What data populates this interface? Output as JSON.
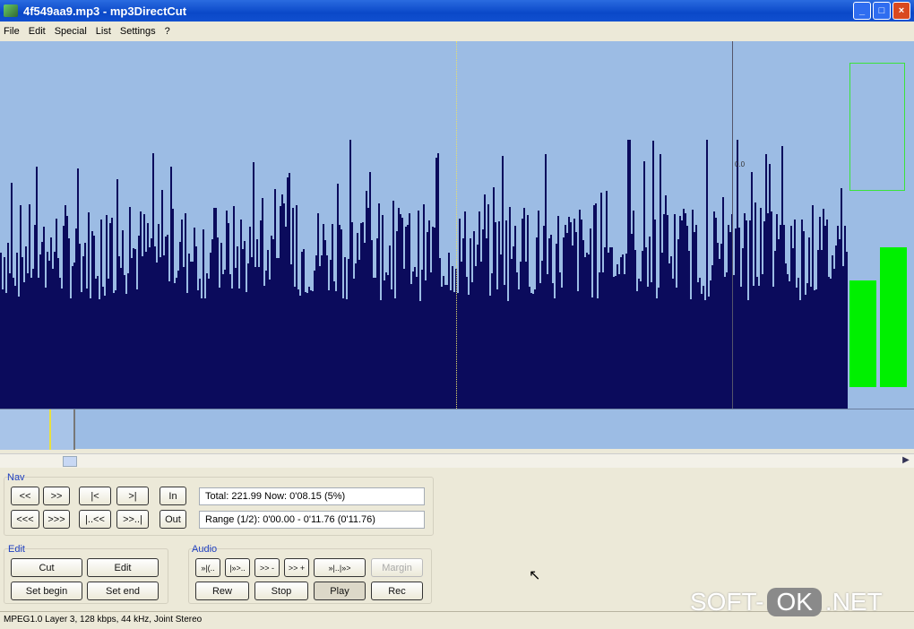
{
  "window": {
    "title": "4f549aa9.mp3 - mp3DirectCut",
    "buttons": [
      "_",
      "□",
      "×"
    ]
  },
  "menu": [
    "File",
    "Edit",
    "Special",
    "List",
    "Settings",
    "?"
  ],
  "waveform": {
    "level_label": "0.0",
    "meter_levels": [
      0.29,
      0.38
    ]
  },
  "nav": {
    "label": "Nav",
    "buttons": [
      "<<",
      ">>",
      "|<",
      ">|",
      "In",
      "<<<",
      ">>>",
      "|..<<",
      ">>..|",
      "Out"
    ],
    "info_total": "Total: 221.99  Now: 0'08.15  (5%)",
    "info_range": "Range (1/2): 0'00.00 - 0'11.76 (0'11.76)"
  },
  "edit": {
    "label": "Edit",
    "buttons": [
      "Cut",
      "Edit",
      "Set begin",
      "Set end"
    ]
  },
  "audio": {
    "label": "Audio",
    "buttons": [
      "»|(..",
      "|»>..",
      ">> -",
      ">> +",
      "»|..|»>",
      "Margin",
      "Rew",
      "Stop",
      "Play",
      "Rec"
    ]
  },
  "status": "MPEG1.0 Layer 3, 128 kbps, 44 kHz, Joint Stereo",
  "watermark": {
    "a": "SOFT-",
    "b": "OK",
    ".c": ".NET",
    "c": ".NET"
  }
}
